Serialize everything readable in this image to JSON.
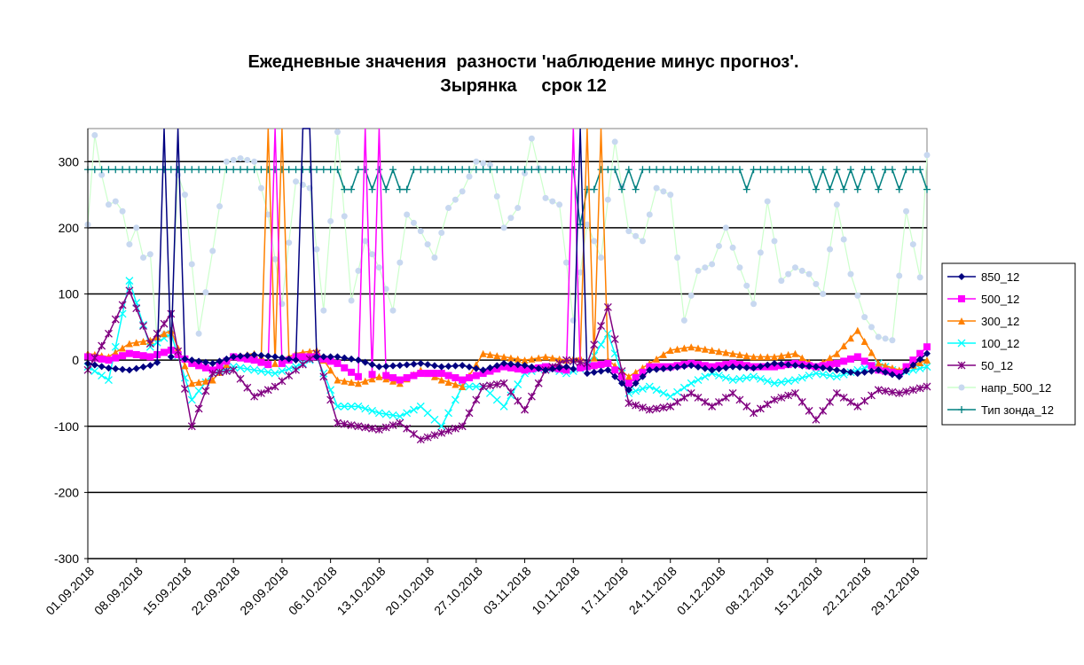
{
  "chart_data": {
    "type": "line",
    "title_line1": "Ежедневные значения  разности 'наблюдение минус прогноз'.",
    "title_line2": "Зырянка     срок 12",
    "xlabel": "",
    "ylabel": "",
    "ylim": [
      -300,
      350
    ],
    "yticks": [
      -300,
      -200,
      -100,
      0,
      100,
      200,
      300
    ],
    "ytick_labels": [
      "-300",
      "-200",
      "-100",
      "0",
      "100",
      "200",
      "300"
    ],
    "xlim": [
      "01.09.2018",
      "31.12.2018"
    ],
    "xtick_labels": [
      "01.09.2018",
      "08.09.2018",
      "15.09.2018",
      "22.09.2018",
      "29.09.2018",
      "06.10.2018",
      "13.10.2018",
      "20.10.2018",
      "27.10.2018",
      "03.11.2018",
      "10.11.2018",
      "17.11.2018",
      "24.11.2018",
      "01.12.2018",
      "08.12.2018",
      "15.12.2018",
      "22.12.2018",
      "29.12.2018"
    ],
    "grid": "horizontal",
    "legend_position": "right",
    "series": [
      {
        "name": "850_12",
        "color": "#000080",
        "marker": "diamond",
        "key_x": [
          0,
          3,
          6,
          9,
          12,
          15,
          18,
          21,
          24,
          27,
          30,
          33,
          36,
          39,
          42,
          45,
          48,
          51,
          54,
          57,
          60,
          63,
          66,
          69,
          72,
          75,
          78,
          81,
          84,
          87,
          90,
          93,
          96,
          99,
          102,
          105,
          108,
          111,
          114,
          117,
          121
        ],
        "key_y": [
          -5,
          -12,
          -15,
          -8,
          5,
          0,
          -5,
          5,
          8,
          5,
          0,
          5,
          5,
          0,
          -10,
          -8,
          -5,
          -10,
          -8,
          -15,
          -5,
          -8,
          -15,
          -10,
          -20,
          -15,
          -45,
          -15,
          -12,
          -8,
          -15,
          -10,
          -12,
          -5,
          -8,
          -10,
          -15,
          -20,
          -15,
          -25,
          10
        ]
      },
      {
        "name": "500_12",
        "color": "#ff00ff",
        "marker": "square",
        "key_x": [
          0,
          3,
          6,
          9,
          12,
          15,
          18,
          21,
          24,
          27,
          30,
          33,
          36,
          39,
          42,
          45,
          48,
          51,
          54,
          57,
          60,
          63,
          66,
          69,
          72,
          75,
          78,
          81,
          84,
          87,
          90,
          93,
          96,
          99,
          102,
          105,
          108,
          111,
          114,
          117,
          121
        ],
        "key_y": [
          5,
          0,
          10,
          5,
          15,
          -5,
          -15,
          5,
          0,
          -10,
          5,
          5,
          -5,
          -25,
          -20,
          -30,
          -20,
          -20,
          -30,
          -20,
          -10,
          -15,
          -10,
          -15,
          -10,
          -5,
          -35,
          -10,
          -10,
          -5,
          -10,
          -5,
          -10,
          -10,
          -5,
          -10,
          -5,
          5,
          -15,
          -20,
          20
        ]
      },
      {
        "name": "300_12",
        "color": "#ff8000",
        "marker": "triangle",
        "key_x": [
          0,
          3,
          6,
          9,
          12,
          15,
          18,
          21,
          24,
          27,
          30,
          33,
          36,
          39,
          42,
          45,
          48,
          51,
          54,
          57,
          60,
          63,
          66,
          69,
          72,
          75,
          78,
          81,
          84,
          87,
          90,
          93,
          96,
          99,
          102,
          105,
          108,
          111,
          114,
          117,
          121
        ],
        "key_y": [
          10,
          5,
          25,
          30,
          45,
          -35,
          -30,
          5,
          10,
          -5,
          10,
          15,
          -30,
          -35,
          -25,
          -35,
          -15,
          -30,
          -40,
          10,
          5,
          0,
          5,
          0,
          5,
          0,
          -25,
          -5,
          15,
          20,
          15,
          10,
          5,
          5,
          10,
          -10,
          10,
          45,
          -5,
          -15,
          0
        ]
      },
      {
        "name": "100_12",
        "color": "#00ffff",
        "marker": "x",
        "key_x": [
          0,
          3,
          6,
          9,
          12,
          15,
          18,
          21,
          24,
          27,
          30,
          33,
          36,
          39,
          42,
          45,
          48,
          51,
          54,
          57,
          60,
          63,
          66,
          69,
          72,
          75,
          78,
          81,
          84,
          87,
          90,
          93,
          96,
          99,
          102,
          105,
          108,
          111,
          114,
          117,
          121
        ],
        "key_y": [
          -10,
          -30,
          120,
          20,
          40,
          -60,
          -20,
          -10,
          -15,
          -20,
          -10,
          5,
          -70,
          -70,
          -80,
          -85,
          -70,
          -100,
          -40,
          -40,
          -70,
          -20,
          -10,
          -20,
          -10,
          40,
          -50,
          -40,
          -55,
          -35,
          -20,
          -30,
          -25,
          -35,
          -30,
          -20,
          -25,
          -15,
          -5,
          -20,
          -10
        ]
      },
      {
        "name": "50_12",
        "color": "#800080",
        "marker": "star",
        "key_x": [
          0,
          3,
          6,
          9,
          12,
          15,
          18,
          21,
          24,
          27,
          30,
          33,
          36,
          39,
          42,
          45,
          48,
          51,
          54,
          57,
          60,
          63,
          66,
          69,
          72,
          75,
          78,
          81,
          84,
          87,
          90,
          93,
          96,
          99,
          102,
          105,
          108,
          111,
          114,
          117,
          121
        ],
        "key_y": [
          -15,
          40,
          105,
          25,
          70,
          -100,
          -20,
          -15,
          -55,
          -40,
          -15,
          10,
          -95,
          -100,
          -105,
          -95,
          -120,
          -110,
          -100,
          -40,
          -35,
          -75,
          -15,
          0,
          -5,
          80,
          -65,
          -75,
          -70,
          -50,
          -70,
          -50,
          -80,
          -60,
          -50,
          -90,
          -50,
          -70,
          -45,
          -50,
          -40
        ]
      },
      {
        "name": "напр_500_12",
        "color": "#ccffcc",
        "marker": "circle",
        "marker_color": "#c8d8f0",
        "key_x": [
          0,
          1,
          2,
          3,
          4,
          5,
          6,
          7,
          8,
          9,
          10,
          11,
          12,
          13,
          14,
          16,
          18,
          20,
          22,
          24,
          26,
          28,
          30,
          32,
          34,
          36,
          38,
          40,
          42,
          44,
          46,
          48,
          50,
          52,
          54,
          56,
          58,
          60,
          62,
          64,
          66,
          68,
          70,
          72,
          74,
          76,
          78,
          80,
          82,
          84,
          86,
          88,
          90,
          92,
          94,
          96,
          98,
          100,
          102,
          104,
          106,
          108,
          110,
          112,
          114,
          116,
          118,
          120,
          121
        ],
        "key_y": [
          205,
          340,
          280,
          235,
          240,
          225,
          175,
          200,
          155,
          160,
          30,
          40,
          35,
          280,
          250,
          40,
          165,
          300,
          305,
          300,
          220,
          85,
          270,
          260,
          75,
          345,
          90,
          180,
          140,
          75,
          220,
          195,
          155,
          230,
          255,
          300,
          295,
          200,
          230,
          335,
          245,
          235,
          60,
          205,
          155,
          330,
          195,
          180,
          260,
          250,
          60,
          135,
          145,
          200,
          140,
          85,
          240,
          120,
          140,
          130,
          100,
          235,
          130,
          65,
          35,
          30,
          225,
          125,
          310
        ]
      },
      {
        "name": "Тип зонда_12",
        "color": "#008080",
        "marker": "plus",
        "key_x": [
          0,
          10,
          20,
          30,
          31,
          32,
          33,
          34,
          35,
          36,
          37,
          38,
          39,
          40,
          41,
          42,
          43,
          44,
          45,
          46,
          47,
          48,
          49,
          50,
          51,
          52,
          53,
          54,
          55,
          56,
          57,
          58,
          59,
          60,
          61,
          62,
          63,
          64,
          65,
          66,
          67,
          68,
          69,
          70,
          71,
          72,
          73,
          74,
          75,
          76,
          77,
          78,
          79,
          80,
          81,
          82,
          83,
          84,
          85,
          86,
          87,
          88,
          89,
          90,
          91,
          92,
          93,
          94,
          95,
          96,
          97,
          98,
          99,
          100,
          101,
          102,
          103,
          104,
          105,
          106,
          107,
          108,
          109,
          110,
          111,
          112,
          113,
          114,
          115,
          116,
          117,
          118,
          119,
          120,
          121
        ],
        "key_y": [
          288,
          288,
          288,
          288,
          288,
          288,
          288,
          288,
          288,
          288,
          258,
          258,
          288,
          288,
          258,
          288,
          258,
          288,
          258,
          258,
          288,
          288,
          288,
          288,
          288,
          288,
          288,
          288,
          288,
          288,
          288,
          288,
          288,
          288,
          288,
          288,
          288,
          288,
          288,
          288,
          288,
          288,
          288,
          288,
          205,
          258,
          258,
          288,
          288,
          288,
          258,
          288,
          258,
          288,
          288,
          288,
          288,
          288,
          288,
          288,
          288,
          288,
          288,
          288,
          288,
          288,
          288,
          288,
          258,
          288,
          288,
          288,
          288,
          288,
          288,
          288,
          288,
          288,
          258,
          288,
          258,
          288,
          258,
          288,
          258,
          288,
          288,
          258,
          288,
          288,
          258,
          288,
          288,
          288,
          258
        ]
      }
    ],
    "spikes": [
      {
        "series": "850_12",
        "x": 11,
        "to": 350
      },
      {
        "series": "850_12",
        "x": 13,
        "to": 350
      },
      {
        "series": "500_12",
        "x": 27,
        "to": 350
      },
      {
        "series": "300_12",
        "x": 26,
        "to": 350
      },
      {
        "series": "300_12",
        "x": 28,
        "to": 350
      },
      {
        "series": "850_12",
        "x": 31,
        "to": 350
      },
      {
        "series": "850_12",
        "x": 32,
        "to": 350
      },
      {
        "series": "500_12",
        "x": 40,
        "to": 350
      },
      {
        "series": "500_12",
        "x": 42,
        "to": 350
      },
      {
        "series": "500_12",
        "x": 70,
        "to": 350
      },
      {
        "series": "850_12",
        "x": 71,
        "to": 350
      },
      {
        "series": "300_12",
        "x": 72,
        "to": 350
      },
      {
        "series": "300_12",
        "x": 74,
        "to": 350
      }
    ]
  }
}
